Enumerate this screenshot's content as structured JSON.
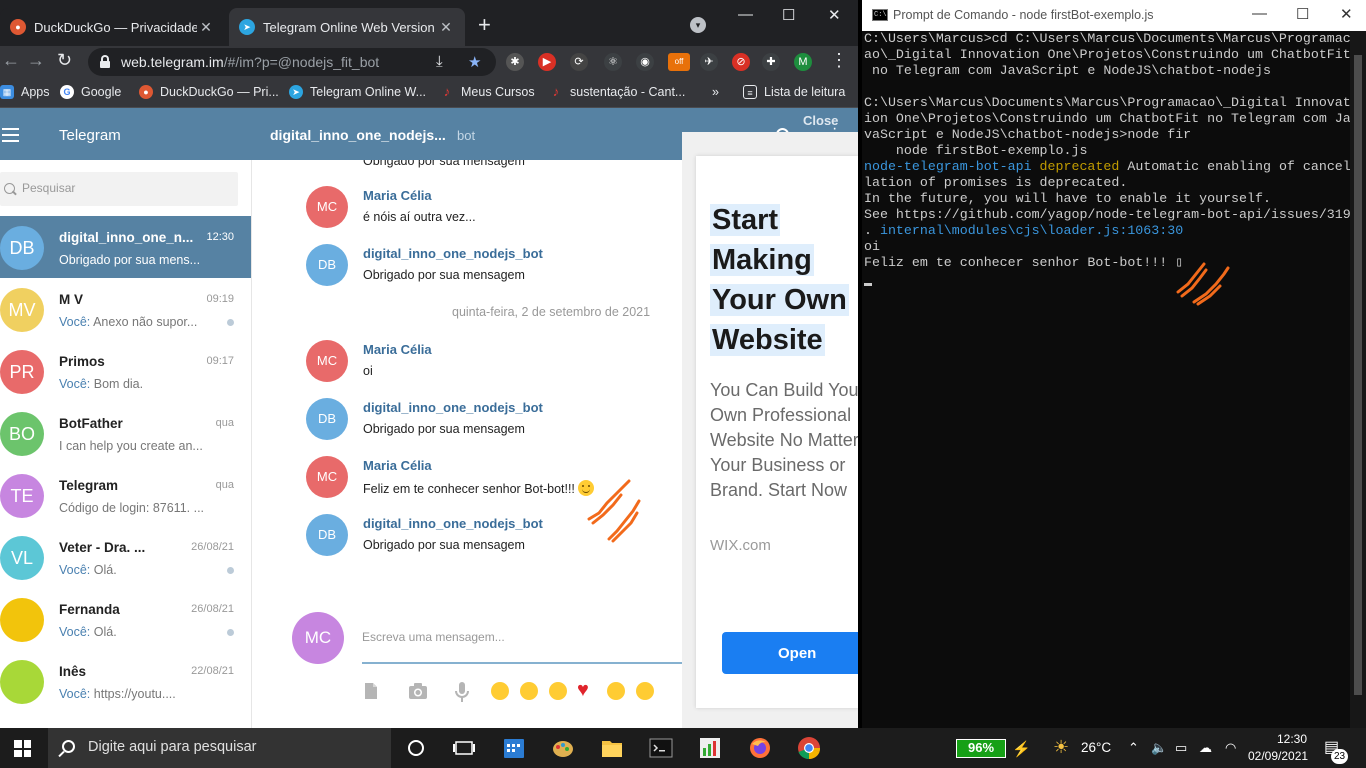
{
  "browser": {
    "tabs": [
      {
        "title": "DuckDuckGo — Privacidade simp",
        "favicon": "duckduckgo-icon",
        "active": false
      },
      {
        "title": "Telegram Online Web Version",
        "favicon": "telegram-icon",
        "active": true
      }
    ],
    "new_tab_symbol": "+",
    "url_host": "web.telegram.im",
    "url_path": "/#/im?p=@nodejs_fit_bot",
    "profile_initial": "M",
    "ext_badge": "off",
    "bookmarks": [
      {
        "label": "Apps",
        "icon": "apps-grid-icon"
      },
      {
        "label": "Google",
        "icon": "google-icon"
      },
      {
        "label": "DuckDuckGo — Pri...",
        "icon": "duckduckgo-icon"
      },
      {
        "label": "Telegram Online W...",
        "icon": "telegram-icon"
      },
      {
        "label": "Meus Cursos",
        "icon": "music-note-icon"
      },
      {
        "label": "sustentação - Cant...",
        "icon": "music-note-icon"
      }
    ],
    "bookmarks_overflow": "»",
    "reading_list": "Lista de leitura"
  },
  "telegram": {
    "brand": "Telegram",
    "peer_name": "digital_inno_one_nodejs...",
    "peer_status": "bot",
    "search_placeholder": "Pesquisar",
    "dialogs": [
      {
        "initials": "DB",
        "name": "digital_inno_one_n...",
        "time": "12:30",
        "you": "",
        "message": "Obrigado por sua mens...",
        "color": "#6aaee0",
        "active": true,
        "unread": false
      },
      {
        "initials": "MV",
        "name": "M V",
        "time": "09:19",
        "you": "Você:",
        "message": "Anexo não supor...",
        "color": "#f0d060",
        "active": false,
        "unread": true
      },
      {
        "initials": "PR",
        "name": "Primos",
        "time": "09:17",
        "you": "Você:",
        "message": "Bom dia.",
        "color": "#e86a6a",
        "active": false,
        "unread": false
      },
      {
        "initials": "BO",
        "name": "BotFather",
        "time": "qua",
        "you": "",
        "message": "I can help you create an...",
        "color": "#6cc46c",
        "active": false,
        "unread": false
      },
      {
        "initials": "TE",
        "name": "Telegram",
        "time": "qua",
        "you": "",
        "message": "Código de login: 87611. ...",
        "color": "#c786e0",
        "active": false,
        "unread": false
      },
      {
        "initials": "VL",
        "name": "Veter - Dra. ...",
        "time": "26/08/21",
        "you": "Você:",
        "message": "Olá.",
        "color": "#5cc7d6",
        "active": false,
        "unread": true
      },
      {
        "initials": "",
        "name": "Fernanda",
        "time": "26/08/21",
        "you": "Você:",
        "message": "Olá.",
        "color": "#f2c40c",
        "active": false,
        "unread": true
      },
      {
        "initials": "",
        "name": "Inês",
        "time": "22/08/21",
        "you": "Você:",
        "message": "https://youtu....",
        "color": "#a8d838",
        "active": false,
        "unread": false
      }
    ],
    "history": [
      {
        "initials": "",
        "author": "",
        "text": "Obrigado por sua mensagem",
        "color": "#6aaee0"
      },
      {
        "initials": "MC",
        "author": "Maria Célia",
        "text": "é nóis aí outra vez...",
        "color": "#e86a6a"
      },
      {
        "initials": "DB",
        "author": "digital_inno_one_nodejs_bot",
        "text": "Obrigado por sua mensagem",
        "color": "#6aaee0"
      },
      {
        "initials": "MC",
        "author": "Maria Célia",
        "text": "oi",
        "color": "#e86a6a"
      },
      {
        "initials": "DB",
        "author": "digital_inno_one_nodejs_bot",
        "text": "Obrigado por sua mensagem",
        "color": "#6aaee0"
      },
      {
        "initials": "MC",
        "author": "Maria Célia",
        "text": "Feliz em te conhecer senhor Bot-bot!!!",
        "color": "#e86a6a",
        "emoji": "smiling-face-emoji"
      },
      {
        "initials": "DB",
        "author": "digital_inno_one_nodejs_bot",
        "text": "Obrigado por sua mensagem",
        "color": "#6aaee0"
      }
    ],
    "date_separator": "quinta-feira, 2 de setembro de 2021",
    "compose_avatar": "MC",
    "compose_placeholder": "Escreva uma mensagem...",
    "ad": {
      "close": "Close",
      "headline": [
        "Start",
        "Making",
        "Your Own",
        "Website"
      ],
      "body": [
        "You Can Build Your",
        "Own Professional",
        "Website No Matter",
        "Your Business or",
        "Brand. Start Now"
      ],
      "brand": "WIX.com",
      "cta": "Open"
    }
  },
  "cmd": {
    "title": "Prompt de Comando - node  firstBot-exemplo.js",
    "lines": [
      {
        "text": "C:\\Users\\Marcus>cd C:\\Users\\Marcus\\Documents\\Marcus\\Programac"
      },
      {
        "text": "ao\\_Digital Innovation One\\Projetos\\Construindo um ChatbotFit"
      },
      {
        "text": " no Telegram com JavaScript e NodeJS\\chatbot-nodejs"
      },
      {
        "text": ""
      },
      {
        "text": "C:\\Users\\Marcus\\Documents\\Marcus\\Programacao\\_Digital Innovat"
      },
      {
        "text": "ion One\\Projetos\\Construindo um ChatbotFit no Telegram com Ja"
      },
      {
        "text": "vaScript e NodeJS\\chatbot-nodejs>node fir"
      },
      {
        "text": "    node firstBot-exemplo.js"
      },
      {
        "text": "",
        "cyan": "node-telegram-bot-api",
        "yellow": " deprecated",
        "rest": " Automatic enabling of cancel"
      },
      {
        "text": "lation of promises is deprecated."
      },
      {
        "text": "In the future, you will have to enable it yourself."
      },
      {
        "text": "See https://github.com/yagop/node-telegram-bot-api/issues/319"
      },
      {
        "text": "",
        "pre": ". ",
        "cyan": "internal\\modules\\cjs\\loader.js:1063:30"
      },
      {
        "text": "oi"
      },
      {
        "text": "Feliz em te conhecer senhor Bot-bot!!! ▯"
      }
    ]
  },
  "taskbar": {
    "search_placeholder": "Digite aqui para pesquisar",
    "battery": "96%",
    "temperature": "26°C",
    "time": "12:30",
    "date": "02/09/2021",
    "notifications": "23"
  }
}
